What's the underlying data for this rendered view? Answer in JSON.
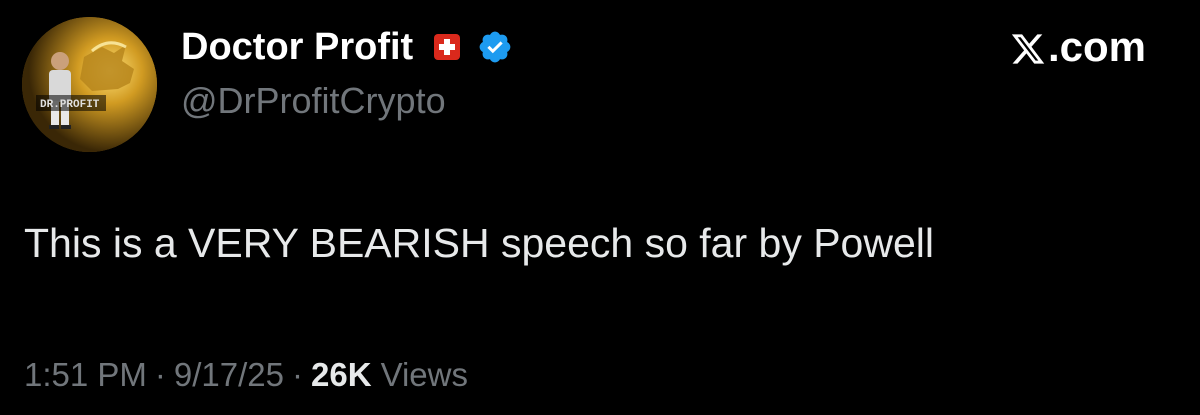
{
  "author": {
    "display_name": "Doctor Profit",
    "handle": "@DrProfitCrypto",
    "avatar_text": "DR.PROFIT",
    "flag_icon": "swiss-flag-icon",
    "verified_icon": "verified-badge-icon"
  },
  "brand": {
    "label": ".com",
    "logo_icon": "x-logo-icon"
  },
  "tweet": {
    "text": "This is a VERY BEARISH speech so far by Powell"
  },
  "meta": {
    "time": "1:51 PM",
    "separator": "·",
    "date": "9/17/25",
    "views_count": "26K",
    "views_label": "Views"
  },
  "colors": {
    "background": "#000000",
    "primary_text": "#e7e9ea",
    "secondary_text": "#71767b",
    "verified_blue": "#1d9bf0",
    "flag_red": "#da291c"
  }
}
